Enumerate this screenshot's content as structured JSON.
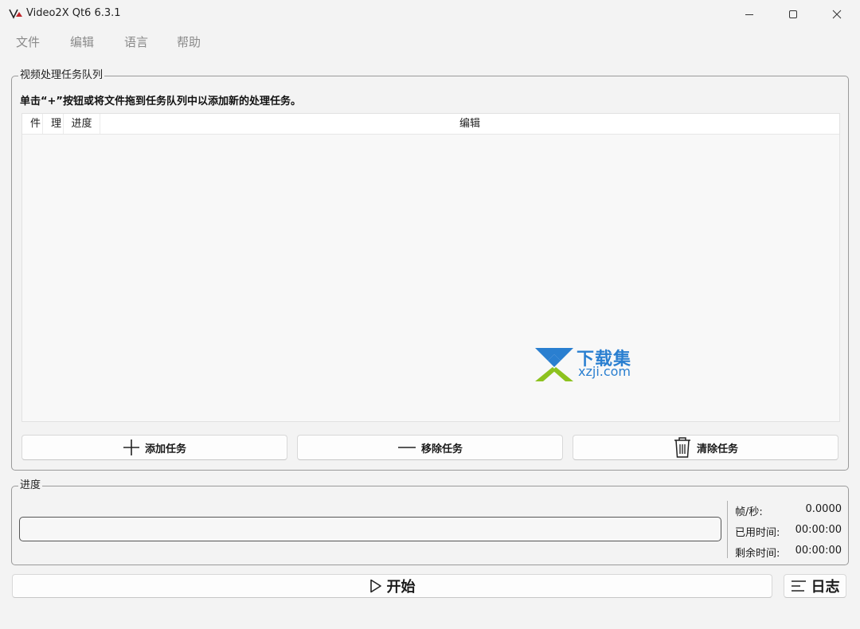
{
  "window": {
    "title": "Video2X Qt6 6.3.1"
  },
  "menu": {
    "items": [
      "文件",
      "编辑",
      "语言",
      "帮助"
    ]
  },
  "queue": {
    "group_title": "视频处理任务队列",
    "hint": "单击“+”按钮或将文件拖到任务队列中以添加新的处理任务。",
    "columns": [
      "件",
      "理",
      "进度",
      "编辑"
    ],
    "add_label": "添加任务",
    "remove_label": "移除任务",
    "clear_label": "清除任务"
  },
  "watermark": {
    "cn": "下载集",
    "en": "xzji.com"
  },
  "progress": {
    "group_title": "进度",
    "percent": 0,
    "fps_label": "帧/秒:",
    "fps_value": "0.0000",
    "elapsed_label": "已用时间:",
    "elapsed_value": "00:00:00",
    "remaining_label": "剩余时间:",
    "remaining_value": "00:00:00"
  },
  "actions": {
    "start_label": "开始",
    "log_label": "日志"
  },
  "colors": {
    "accent": "#3b8ee0",
    "watermark_blue": "#2a7fd0",
    "watermark_green": "#8dc21f"
  }
}
